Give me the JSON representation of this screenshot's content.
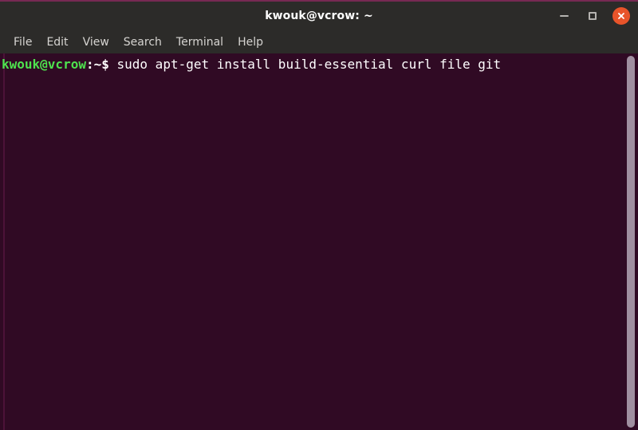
{
  "window": {
    "title": "kwouk@vcrow: ~",
    "accent_color": "#772953",
    "titlebar_color": "#2c2b29",
    "terminal_background": "#300a24",
    "controls": {
      "minimize_label": "Minimize",
      "maximize_label": "Maximize",
      "close_label": "Close",
      "close_color": "#e8542a"
    }
  },
  "menubar": {
    "items": [
      {
        "label": "File"
      },
      {
        "label": "Edit"
      },
      {
        "label": "View"
      },
      {
        "label": "Search"
      },
      {
        "label": "Terminal"
      },
      {
        "label": "Help"
      }
    ]
  },
  "terminal": {
    "prompt_user_host": "kwouk@vcrow",
    "prompt_separator": ":~$",
    "command": "sudo apt-get install build-essential curl file git",
    "prompt_color": "#4ee24e",
    "text_color": "#ffffff"
  },
  "scrollbar": {
    "thumb_color": "#a08fa0"
  }
}
